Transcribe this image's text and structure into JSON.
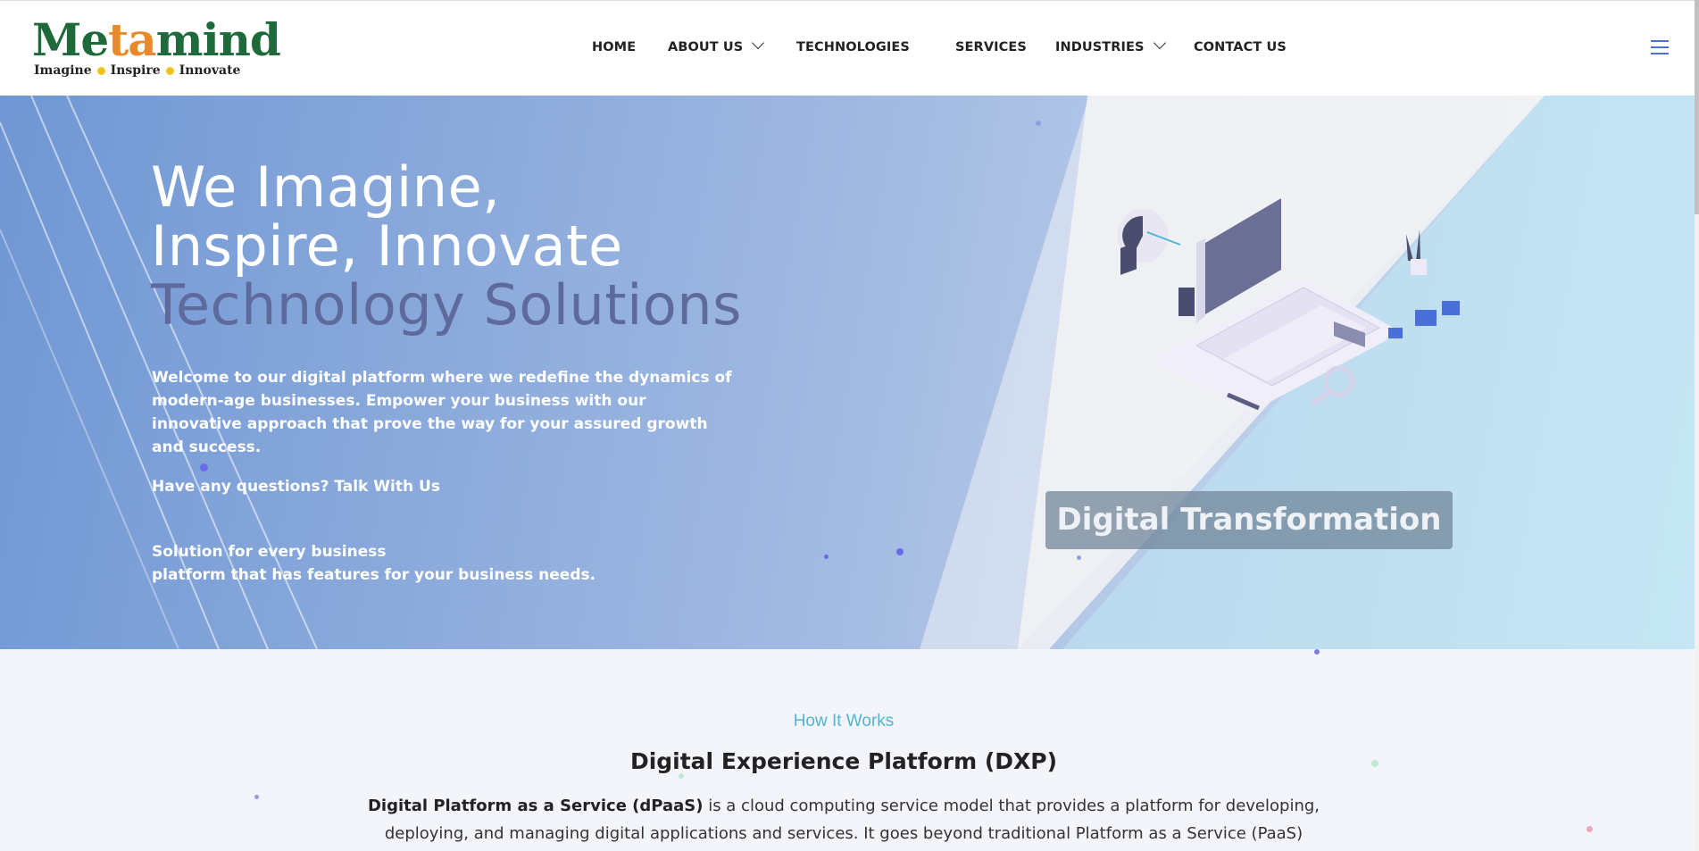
{
  "logo": {
    "word_pre": "Me",
    "word_mid": "ta",
    "word_post": "mind",
    "tag1": "Imagine",
    "tag2": "Inspire",
    "tag3": "Innovate"
  },
  "nav": {
    "items": [
      {
        "label": "HOME"
      },
      {
        "label": "ABOUT US"
      },
      {
        "label": "TECHNOLOGIES"
      },
      {
        "label": "SERVICES"
      },
      {
        "label": "INDUSTRIES"
      },
      {
        "label": "CONTACT US"
      }
    ]
  },
  "hero": {
    "title_line1": "We Imagine,",
    "title_line2": "Inspire, Innovate",
    "title_line3": "Technology Solutions",
    "description": "Welcome to our digital platform where we redefine the dynamics of modern-age businesses. Empower your business with our innovative approach that prove the way for your assured growth and success.",
    "questions": "Have any questions? Talk With Us",
    "solution_line1": "Solution for every business",
    "solution_line2": "platform that has features for your business needs.",
    "badge": "Digital Transformation"
  },
  "how": {
    "label": "How It Works",
    "title": "Digital Experience Platform (DXP)",
    "body_bold": "Digital Platform as a Service (dPaaS)",
    "body_rest": " is a cloud computing service model that provides a platform for developing, deploying, and managing digital applications and services. It goes beyond traditional Platform as a Service (PaaS) offerings by focusing on the"
  },
  "colors": {
    "brand_green": "#1f6a3b",
    "brand_orange": "#e8892a",
    "accent_blue": "#4fb4d8",
    "hero_title_muted": "#5f6a9c"
  }
}
